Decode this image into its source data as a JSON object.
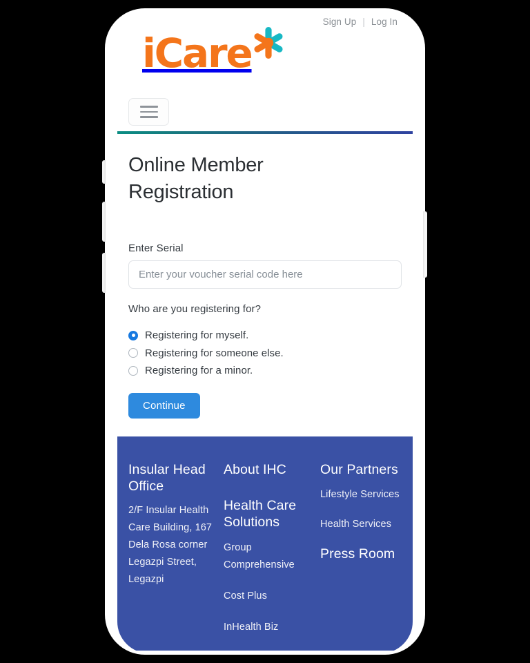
{
  "device": {
    "type": "smartphone-mockup",
    "frame_color": "#ffffff",
    "background_color": "#000000"
  },
  "utility": {
    "sign_up": "Sign Up",
    "divider": "|",
    "log_in": "Log In"
  },
  "brand": {
    "name": "iCare",
    "logo_text_color": "#F4751B",
    "logo_accent_color": "#18B8C4",
    "asterisk_icon": "asterisk-icon"
  },
  "navbar": {
    "menu_icon": "hamburger-menu-icon",
    "menu_label": "Toggle navigation"
  },
  "accent": {
    "rule_gradient_start": "#0b8d83",
    "rule_gradient_end": "#2f43a0",
    "primary_button": "#2e8ade",
    "radio_selected": "#1779e0",
    "footer_background": "#3A51A5"
  },
  "main": {
    "title": "Online Member Registration",
    "serial": {
      "label": "Enter Serial",
      "placeholder": "Enter your voucher serial code here",
      "value": ""
    },
    "question": "Who are you registering for?",
    "options": [
      {
        "label": "Registering for myself.",
        "selected": true
      },
      {
        "label": "Registering for someone else.",
        "selected": false
      },
      {
        "label": "Registering for a minor.",
        "selected": false
      }
    ],
    "continue_label": "Continue"
  },
  "footer": {
    "col1": {
      "heading": "Insular Head Office",
      "address": "2/F Insular Health Care Building, 167 Dela Rosa corner Legazpi Street, Legazpi"
    },
    "col2": {
      "heading_1": "About IHC",
      "heading_2": "Health Care Solutions",
      "links": [
        "Group Comprehensive",
        "Cost Plus",
        "InHealth Biz"
      ]
    },
    "col3": {
      "heading_1": "Our Partners",
      "links": [
        "Lifestyle Services",
        "Health Services"
      ],
      "heading_2": "Press Room"
    }
  }
}
